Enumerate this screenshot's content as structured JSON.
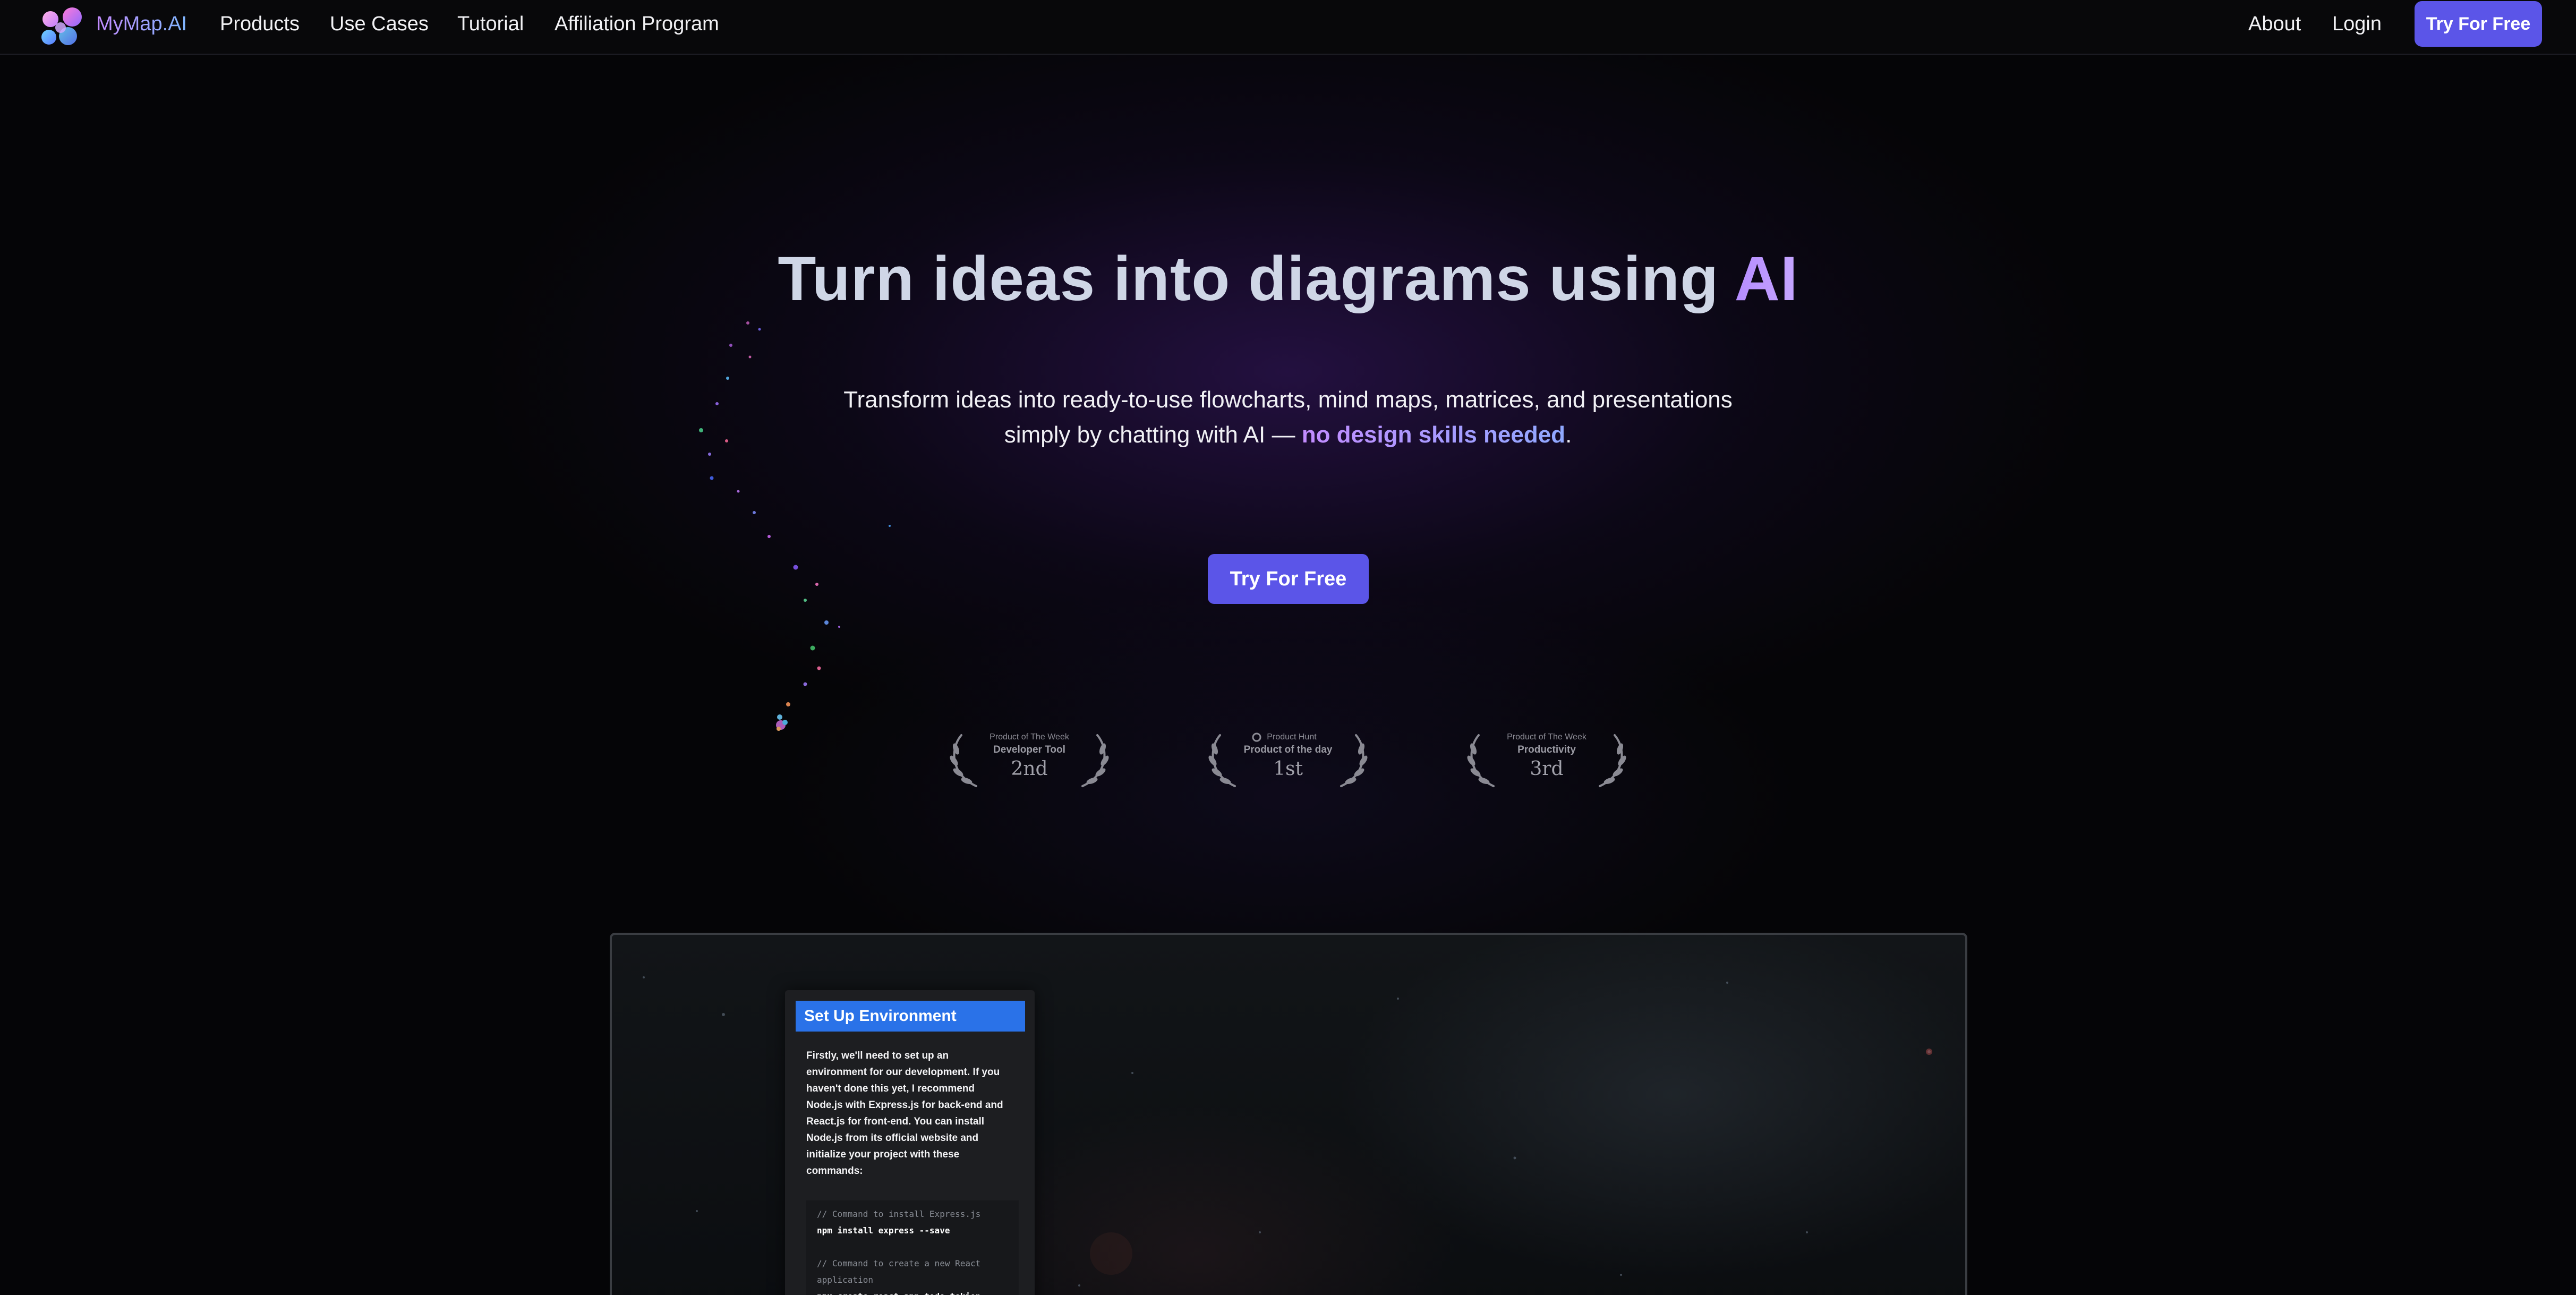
{
  "nav": {
    "brand": "MyMap.AI",
    "links": [
      "Products",
      "Use Cases",
      "Tutorial",
      "Affiliation Program"
    ],
    "right_links": [
      "About",
      "Login"
    ],
    "cta_label": "Try For Free",
    "colors": {
      "background": "#08080a",
      "cta": "#5b55e8"
    }
  },
  "hero": {
    "title_main": "Turn ideas into diagrams using ",
    "title_accent": "AI",
    "subtitle_line1": "Transform ideas into ready-to-use flowcharts, mind maps, matrices, and presentations",
    "subtitle_line2_prefix": "simply by chatting with AI — ",
    "subtitle_highlight": "no design skills needed",
    "subtitle_suffix": ".",
    "cta_label": "Try For Free",
    "colors": {
      "accent": "#b58cff",
      "cta": "#5b55e8"
    }
  },
  "awards": [
    {
      "kicker": "Product of The Week",
      "category": "Developer Tool",
      "rank": "2nd"
    },
    {
      "kicker": "Product Hunt",
      "category": "Product of the day",
      "rank": "1st"
    },
    {
      "kicker": "Product of The Week",
      "category": "Productivity",
      "rank": "3rd"
    }
  ],
  "preview": {
    "node_title": "Set Up Environment",
    "node_body": "Firstly, we'll need to set up an environment for our development. If you haven't done this yet, I recommend Node.js with Express.js for back-end and React.js for front-end. You can install Node.js from its official website and initialize your project with these commands:",
    "code": {
      "comment1": "// Command to install Express.js",
      "cmd1": "npm install express --save",
      "comment2": "// Command to create a new React",
      "comment2b": "application",
      "cmd2": "npx create-react-app todo-tekion"
    },
    "colors": {
      "node_header": "#2a72e8"
    }
  }
}
